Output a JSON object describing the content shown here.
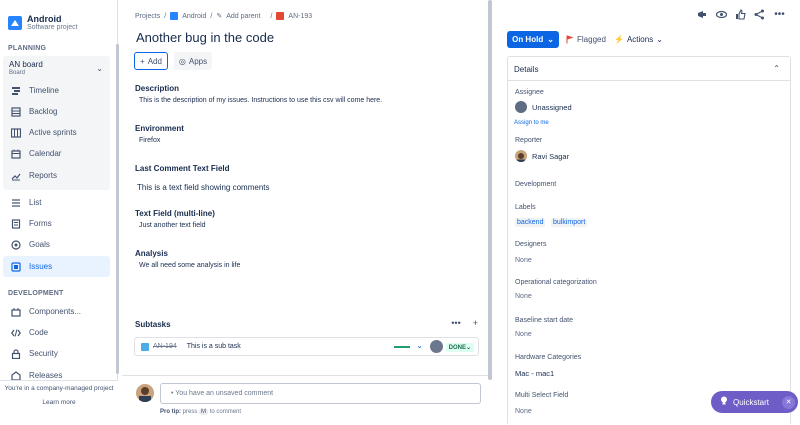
{
  "sidebar": {
    "project_name": "Android",
    "project_type": "Software project",
    "planning_label": "PLANNING",
    "board": {
      "name": "AN board",
      "type": "Board"
    },
    "planning_items": [
      {
        "label": "Timeline",
        "icon": "timeline-icon"
      },
      {
        "label": "Backlog",
        "icon": "backlog-icon"
      },
      {
        "label": "Active sprints",
        "icon": "board-icon"
      },
      {
        "label": "Calendar",
        "icon": "calendar-icon"
      },
      {
        "label": "Reports",
        "icon": "reports-icon"
      }
    ],
    "items": [
      {
        "label": "List",
        "icon": "list-icon"
      },
      {
        "label": "Forms",
        "icon": "forms-icon"
      },
      {
        "label": "Goals",
        "icon": "goals-icon"
      },
      {
        "label": "Issues",
        "icon": "issues-icon",
        "active": true
      }
    ],
    "development_label": "DEVELOPMENT",
    "dev_items": [
      {
        "label": "Components...",
        "icon": "components-icon"
      },
      {
        "label": "Code",
        "icon": "code-icon"
      },
      {
        "label": "Security",
        "icon": "security-icon"
      },
      {
        "label": "Releases",
        "icon": "releases-icon"
      }
    ],
    "footer_text": "You're in a company-managed project",
    "learn_more": "Learn more"
  },
  "breadcrumb": {
    "projects": "Projects",
    "project": "Android",
    "add_parent": "Add parent",
    "issue_key": "AN-193",
    "sep": "/"
  },
  "issue": {
    "title": "Another bug in the code",
    "add_label": "Add",
    "apps_label": "Apps",
    "fields": [
      {
        "name": "Description",
        "value": "This is the description of my issues. Instructions to use this csv will come here."
      },
      {
        "name": "Environment",
        "value": "Firefox"
      },
      {
        "name": "Last Comment Text Field",
        "value": "This is a text field showing comments"
      },
      {
        "name": "Text Field (multi-line)",
        "value": "Just another text field"
      },
      {
        "name": "Analysis",
        "value": "We all need some analysis in life"
      }
    ]
  },
  "subtasks": {
    "title": "Subtasks",
    "more": "•••",
    "add": "+",
    "rows": [
      {
        "key": "AN-194",
        "summary": "This is a sub task",
        "status": "DONE",
        "progress": 1.0
      }
    ]
  },
  "comment": {
    "placeholder": "• You have an unsaved comment",
    "protip_prefix": "Pro tip:",
    "protip_press": "press",
    "protip_key": "M",
    "protip_suffix": "to comment"
  },
  "right": {
    "status": "On Hold",
    "flag_label": "Flagged",
    "actions_label": "Actions",
    "details_title": "Details",
    "assignee_label": "Assignee",
    "assignee_value": "Unassigned",
    "assign_to_me": "Assign to me",
    "reporter_label": "Reporter",
    "reporter_value": "Ravi Sagar",
    "development_label": "Development",
    "labels_label": "Labels",
    "labels": [
      "backend",
      "bulkimport"
    ],
    "designers_label": "Designers",
    "designers_value": "None",
    "opcat_label": "Operational categorization",
    "opcat_value": "None",
    "baseline_label": "Baseline start date",
    "baseline_value": "None",
    "hardware_label": "Hardware Categories",
    "hardware_value": "Mac - mac1",
    "mselect_label": "Multi Select Field",
    "mselect_value": "None",
    "quickstart": "Quickstart"
  },
  "colors": {
    "accent": "#0c66e4",
    "quickstart": "#6e5dc6",
    "done": "#22a06b",
    "flag": "#e34935"
  }
}
